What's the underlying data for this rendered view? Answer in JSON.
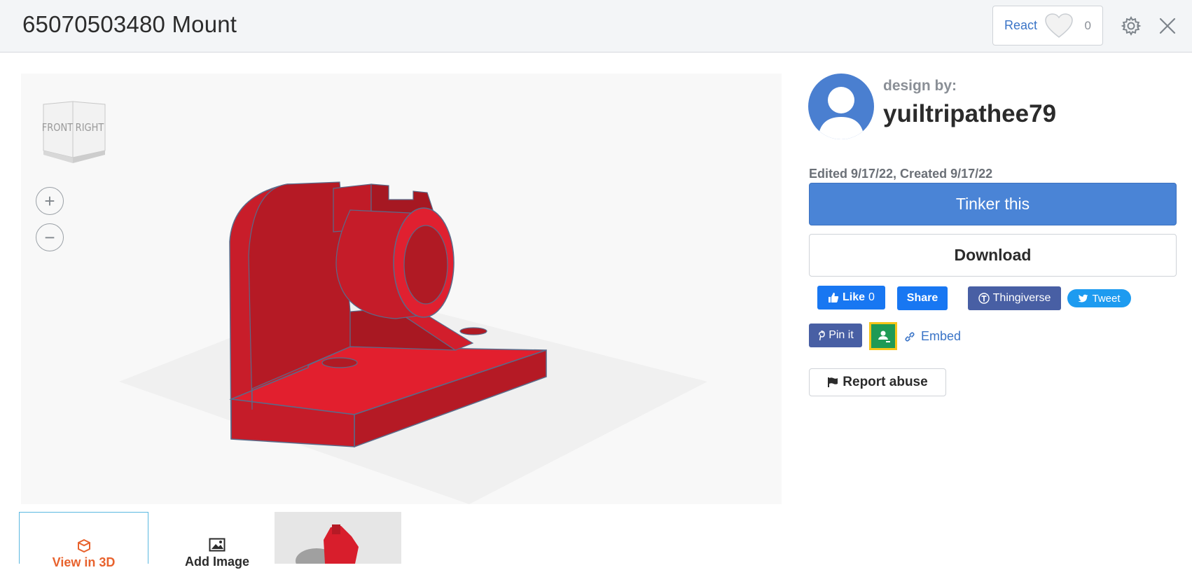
{
  "header": {
    "title": "65070503480 Mount",
    "react_label": "React",
    "react_count": "0"
  },
  "viewer": {
    "viewcube_front": "FRONT",
    "viewcube_right": "RIGHT",
    "zoom_in": "+",
    "zoom_out": "−"
  },
  "thumbnails": {
    "view_3d_label": "View in 3D",
    "add_image_label": "Add Image"
  },
  "designer": {
    "design_by_label": "design by:",
    "username": "yuiltripathee79",
    "dates": "Edited 9/17/22, Created 9/17/22"
  },
  "actions": {
    "tinker_label": "Tinker this",
    "download_label": "Download",
    "report_label": "Report abuse"
  },
  "share": {
    "fb_like_label": "Like",
    "fb_like_count": "0",
    "fb_share_label": "Share",
    "thingiverse_label": "Thingiverse",
    "tweet_label": "Tweet",
    "pin_label": "Pin it",
    "embed_label": "Embed"
  },
  "colors": {
    "accent_blue": "#4a84d6",
    "model_red": "#d81e2c",
    "view3d_orange": "#e8622d",
    "facebook": "#1877f2",
    "twitter": "#1d9bf0"
  }
}
